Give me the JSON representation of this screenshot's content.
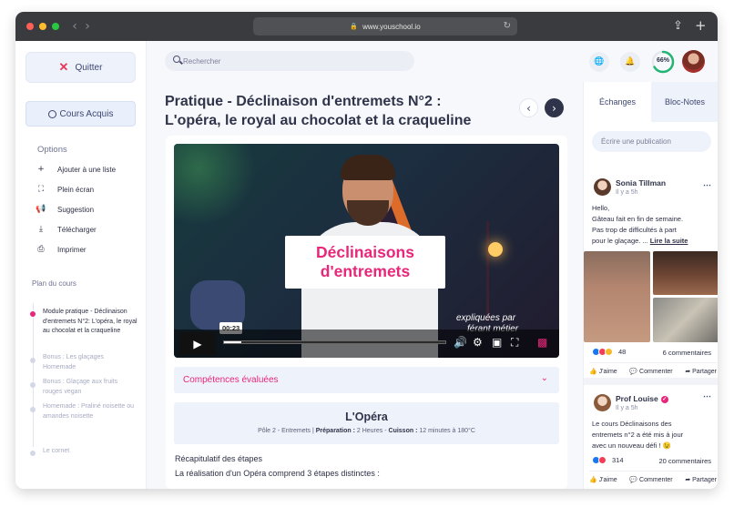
{
  "browser": {
    "url": "www.youschool.io"
  },
  "sidebar": {
    "quit_label": "Quitter",
    "acquired_label": "Cours Acquis",
    "options_title": "Options",
    "options": [
      {
        "label": "Ajouter à une liste",
        "icon": "plus-icon"
      },
      {
        "label": "Plein écran",
        "icon": "fullscreen-icon"
      },
      {
        "label": "Suggestion",
        "icon": "megaphone-icon"
      },
      {
        "label": "Télécharger",
        "icon": "download-icon"
      },
      {
        "label": "Imprimer",
        "icon": "print-icon"
      }
    ],
    "plan_title": "Plan du cours",
    "plan_items": [
      {
        "label": "Module pratique - Déclinaison d'entremets N°2: L'opéra, le royal au chocolat et la craqueline",
        "active": true
      },
      {
        "label": "Bonus : Les glaçages Homemade",
        "active": false
      },
      {
        "label": "Bonus : Glaçage aux fruits rouges vegan",
        "active": false
      },
      {
        "label": "Homemade : Praliné noisette ou amandes noisette",
        "active": false
      },
      {
        "label": "Le cornet",
        "active": false
      }
    ]
  },
  "header": {
    "search_placeholder": "Rechercher",
    "progress_label": "66%",
    "progress_value": 0.66
  },
  "lesson": {
    "title_line1": "Pratique - Déclinaison d'entremets N°2 :",
    "title_line2": "L'opéra, le royal au chocolat et la craqueline",
    "video": {
      "title_line1": "Déclinaisons",
      "title_line2": "d'entremets",
      "subtitle_line1": "expliquées par",
      "subtitle_line2": "férant métier",
      "time": "00:23"
    },
    "competences_label": "Compétences évaluées",
    "recipe": {
      "name": "L'Opéra",
      "pole": "Pôle 2 - Entremets | ",
      "prep_label": "Préparation :",
      "prep_value": " 2 Heures - ",
      "cook_label": "Cuisson :",
      "cook_value": " 12 minutes à 180°C"
    },
    "recap_title": "Récapitulatif des étapes",
    "recap_text": "La réalisation d'un Opéra comprend 3 étapes distinctes :"
  },
  "panel": {
    "tab_exchanges": "Échanges",
    "tab_notes": "Bloc-Notes",
    "publish_placeholder": "Écrire une publication",
    "posts": [
      {
        "author": "Sonia Tillman",
        "time": "Il y a 5h",
        "text_lines": [
          "Hello,",
          "Gâteau fait en fin de semaine.",
          "Pas trop de difficultés à part",
          "pour le glaçage. ... "
        ],
        "read_more": "Lire la suite",
        "reactions": "48",
        "comments": "6 commentaires"
      },
      {
        "author": "Prof Louise",
        "time": "Il y a 5h",
        "text_lines": [
          "Le cours Déclinaisons des",
          "entremets n°2 a été mis à jour",
          "avec un nouveau défi ! 😉"
        ],
        "reactions": "314",
        "comments": "20 commentaires"
      }
    ],
    "actions": {
      "like": "J'aime",
      "comment": "Commenter",
      "share": "Partager"
    }
  },
  "colors": {
    "accent": "#e8277a",
    "progress": "#22b573",
    "navy": "#2f344a"
  }
}
